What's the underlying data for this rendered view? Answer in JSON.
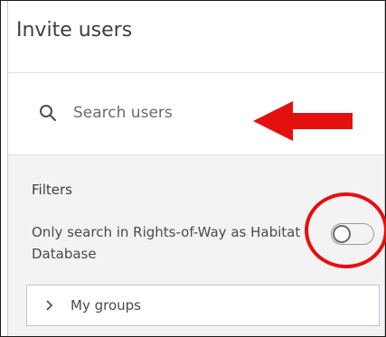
{
  "panel": {
    "title": "Invite users"
  },
  "search": {
    "placeholder": "Search users",
    "icon": "search-icon"
  },
  "filters": {
    "heading": "Filters",
    "toggle_label": "Only search in Rights-of-Way as Habitat Database",
    "toggle_on": false
  },
  "groups": {
    "label": "My groups",
    "icon": "chevron-right-icon",
    "expanded": false
  },
  "annotations": {
    "arrow_color": "#e41010",
    "circle_color": "#e41010"
  }
}
